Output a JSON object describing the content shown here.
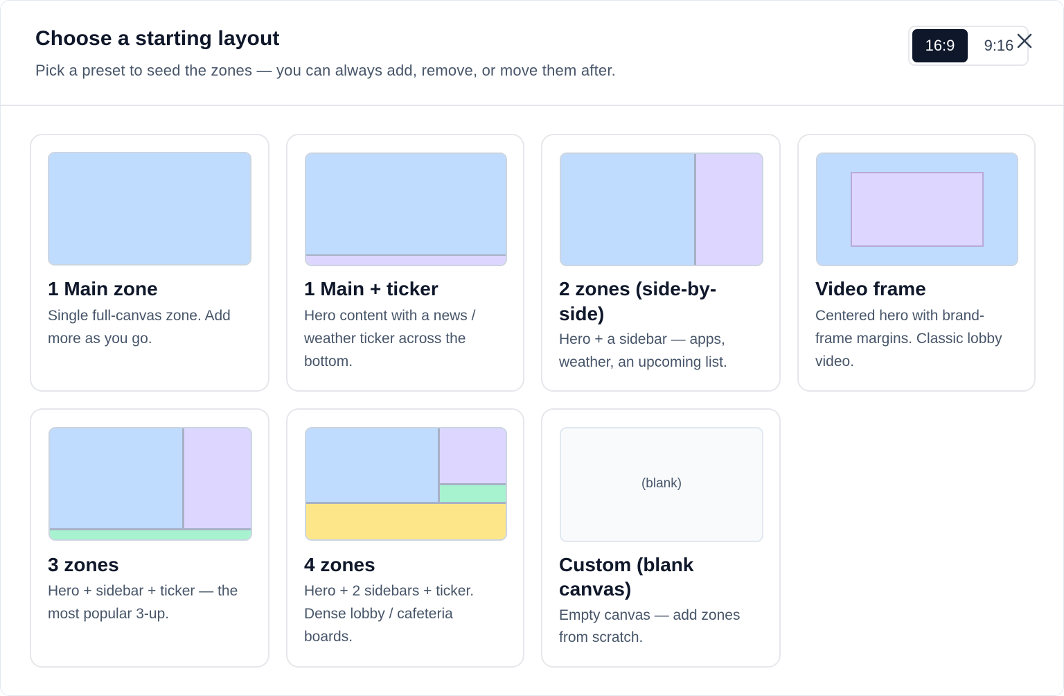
{
  "dialog": {
    "title": "Choose a starting layout",
    "subtitle": "Pick a preset to seed the zones — you can always add, remove, or move them after.",
    "aspect_ratio": {
      "options": [
        "16:9",
        "9:16"
      ],
      "selected": "16:9"
    },
    "close_icon": "close-icon"
  },
  "layouts": [
    {
      "name": "1 Main zone",
      "description": "Single full-canvas zone. Add more as you go."
    },
    {
      "name": "1 Main + ticker",
      "description": "Hero content with a news / weather ticker across the bottom."
    },
    {
      "name": "2 zones (side-by-side)",
      "description": "Hero + a sidebar — apps, weather, an upcoming list."
    },
    {
      "name": "Video frame",
      "description": "Centered hero with brand-frame margins. Classic lobby video."
    },
    {
      "name": "3 zones",
      "description": "Hero + sidebar + ticker — the most popular 3-up."
    },
    {
      "name": "4 zones",
      "description": "Hero + 2 sidebars + ticker. Dense lobby / cafeteria boards."
    },
    {
      "name": "Custom (blank canvas)",
      "description": "Empty canvas — add zones from scratch.",
      "preview_label": "(blank)"
    }
  ],
  "colors": {
    "zone_primary": "#bfdbfe",
    "zone_secondary": "#ddd6fe",
    "zone_ticker": "#a7f3d0",
    "zone_quaternary": "#fde68a",
    "active_toggle": "#0f172a"
  }
}
